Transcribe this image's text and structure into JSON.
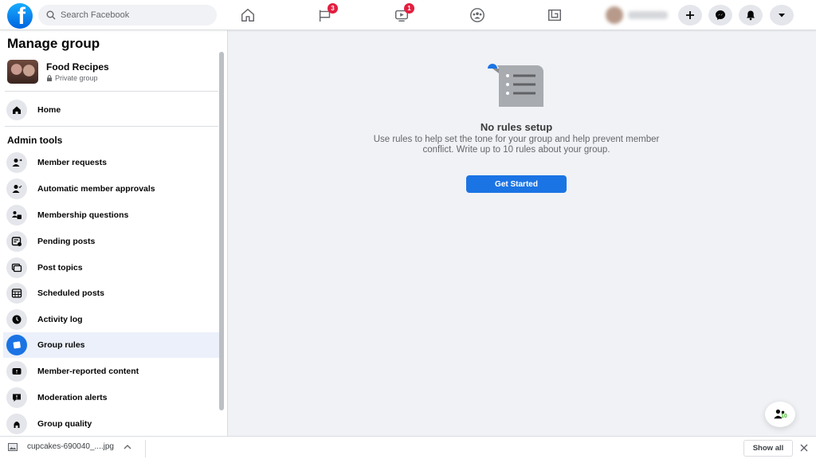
{
  "topbar": {
    "logo": "facebook-logo",
    "search_placeholder": "Search Facebook",
    "nav": [
      {
        "name": "home",
        "icon": "home-icon",
        "badge": null
      },
      {
        "name": "pages",
        "icon": "flag-icon",
        "badge": "3"
      },
      {
        "name": "watch",
        "icon": "video-icon",
        "badge": "1"
      },
      {
        "name": "groups",
        "icon": "groups-icon",
        "badge": null
      },
      {
        "name": "gaming",
        "icon": "gaming-icon",
        "badge": null
      }
    ],
    "actions": [
      {
        "name": "create",
        "icon": "plus-icon"
      },
      {
        "name": "messenger",
        "icon": "messenger-icon"
      },
      {
        "name": "notifications",
        "icon": "bell-icon"
      },
      {
        "name": "account",
        "icon": "caret-down-icon"
      }
    ]
  },
  "sidebar": {
    "title": "Manage group",
    "group": {
      "name": "Food Recipes",
      "privacy": "Private group"
    },
    "home_label": "Home",
    "section_title": "Admin tools",
    "items": [
      {
        "label": "Member requests",
        "icon": "member-requests-icon",
        "active": false
      },
      {
        "label": "Automatic member approvals",
        "icon": "member-approvals-icon",
        "active": false
      },
      {
        "label": "Membership questions",
        "icon": "membership-questions-icon",
        "active": false
      },
      {
        "label": "Pending posts",
        "icon": "pending-posts-icon",
        "active": false
      },
      {
        "label": "Post topics",
        "icon": "post-topics-icon",
        "active": false
      },
      {
        "label": "Scheduled posts",
        "icon": "calendar-icon",
        "active": false
      },
      {
        "label": "Activity log",
        "icon": "clock-icon",
        "active": false
      },
      {
        "label": "Group rules",
        "icon": "rules-icon",
        "active": true
      },
      {
        "label": "Member-reported content",
        "icon": "report-icon",
        "active": false
      },
      {
        "label": "Moderation alerts",
        "icon": "alert-bubble-icon",
        "active": false
      },
      {
        "label": "Group quality",
        "icon": "quality-icon",
        "active": false
      }
    ]
  },
  "main": {
    "empty_title": "No rules setup",
    "empty_description": "Use rules to help set the tone for your group and help prevent member conflict. Write up to 10 rules about your group.",
    "cta_label": "Get Started",
    "float_count": "10"
  },
  "download_bar": {
    "file_name": "cupcakes-690040_....jpg",
    "show_all_label": "Show all"
  },
  "colors": {
    "accent": "#1b74e4",
    "badge": "#e41e3f",
    "active_bg": "#ebf0fa"
  }
}
